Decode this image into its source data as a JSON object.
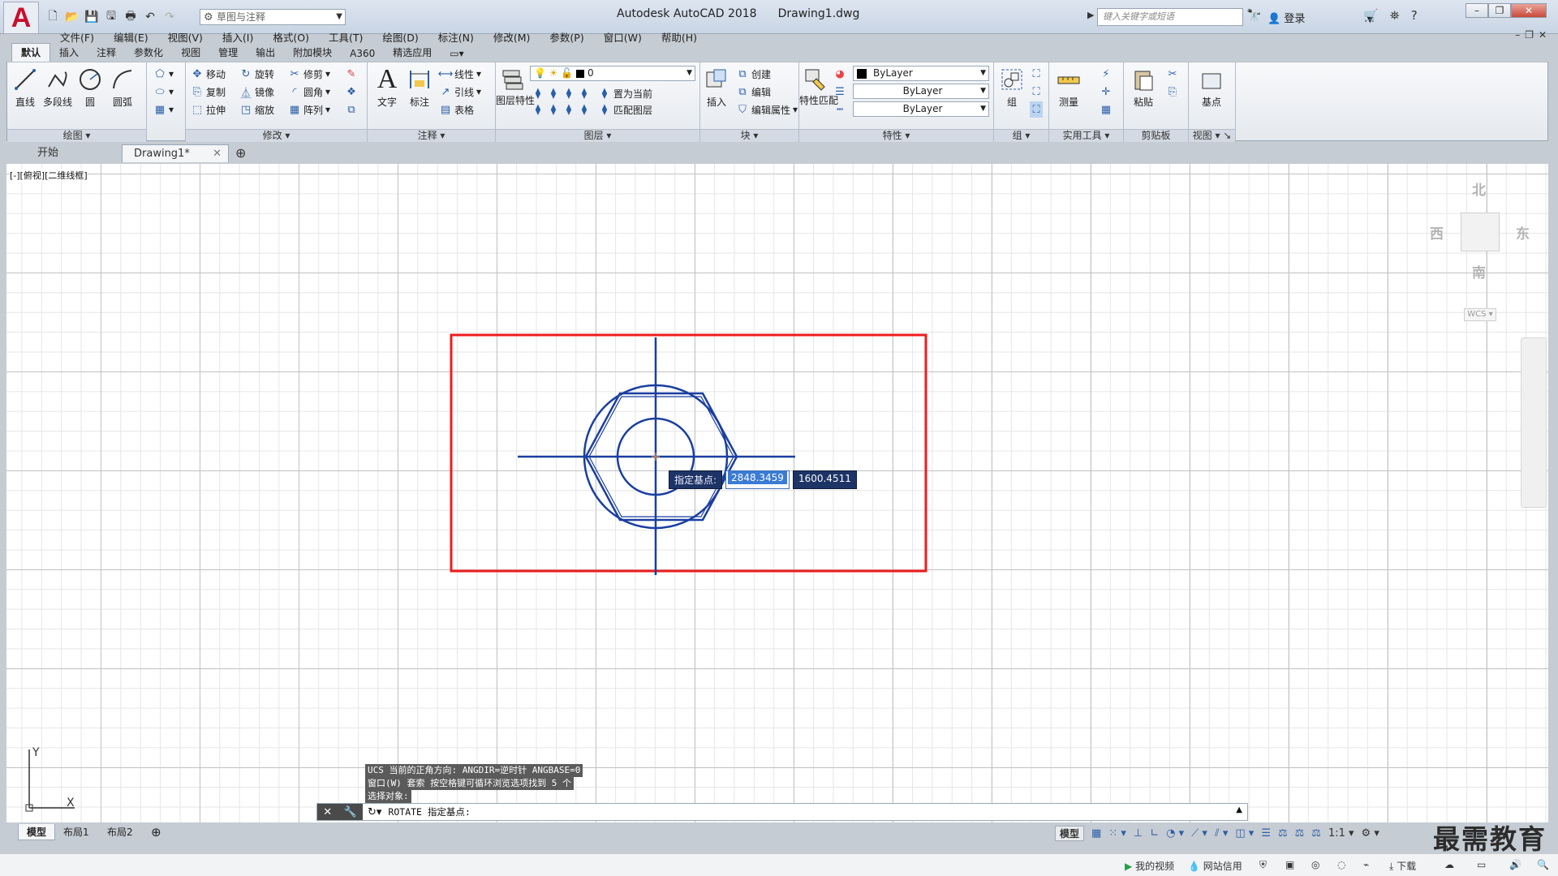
{
  "titlebar": {
    "app_name": "Autodesk AutoCAD 2018",
    "file_name": "Drawing1.dwg",
    "workspace": "草图与注释",
    "search_placeholder": "键入关键字或短语",
    "login": "登录",
    "logo": "A"
  },
  "menu": [
    "文件(F)",
    "编辑(E)",
    "视图(V)",
    "插入(I)",
    "格式(O)",
    "工具(T)",
    "绘图(D)",
    "标注(N)",
    "修改(M)",
    "参数(P)",
    "窗口(W)",
    "帮助(H)"
  ],
  "ribbon_tabs": [
    "默认",
    "插入",
    "注释",
    "参数化",
    "视图",
    "管理",
    "输出",
    "附加模块",
    "A360",
    "精选应用"
  ],
  "ribbon": {
    "draw": {
      "title": "绘图",
      "line": "直线",
      "polyline": "多段线",
      "circle": "圆",
      "arc": "圆弧"
    },
    "modify": {
      "title": "修改",
      "move": "移动",
      "rotate": "旋转",
      "trim": "修剪",
      "copy": "复制",
      "mirror": "镜像",
      "fillet": "圆角",
      "stretch": "拉伸",
      "scale": "缩放",
      "array": "阵列"
    },
    "annotation": {
      "title": "注释",
      "text": "文字",
      "dimension": "标注",
      "linear": "线性",
      "leader": "引线",
      "table": "表格"
    },
    "layers": {
      "title": "图层",
      "layer_props": "图层特性",
      "current_layer": "0",
      "set_current": "置为当前",
      "match_layer": "匹配图层"
    },
    "block": {
      "title": "块",
      "insert": "插入",
      "create": "创建",
      "edit": "编辑",
      "edit_attr": "编辑属性"
    },
    "properties": {
      "title": "特性",
      "match": "特性匹配",
      "color": "ByLayer",
      "linetype": "ByLayer",
      "lineweight": "ByLayer"
    },
    "groups": {
      "title": "组",
      "group": "组"
    },
    "utilities": {
      "title": "实用工具",
      "measure": "测量"
    },
    "clipboard": {
      "title": "剪贴板",
      "paste": "粘贴"
    },
    "view": {
      "title": "视图",
      "base": "基点"
    }
  },
  "doc_tabs": {
    "start": "开始",
    "drawing": "Drawing1*"
  },
  "viewport_label": "[-][俯视][二维线框]",
  "viewcube": {
    "north": "北",
    "south": "南",
    "east": "东",
    "west": "西",
    "wcs": "WCS"
  },
  "dynamic_input": {
    "prompt": "指定基点:",
    "x": "2848.3459",
    "y": "1600.4511"
  },
  "command_history": [
    "UCS 当前的正角方向:  ANGDIR=逆时针  ANGBASE=0",
    "窗口(W) 套索  按空格键可循环浏览选项找到 5 个",
    "选择对象:"
  ],
  "command_line": "ROTATE 指定基点:",
  "ucs_axes": {
    "x": "X",
    "y": "Y"
  },
  "layout_tabs": [
    "模型",
    "布局1",
    "布局2"
  ],
  "status": {
    "model": "模型",
    "scale": "1:1"
  },
  "watermark": "最需教育",
  "taskbar": {
    "video": "我的视频",
    "credit": "网站信用",
    "download": "下载"
  }
}
